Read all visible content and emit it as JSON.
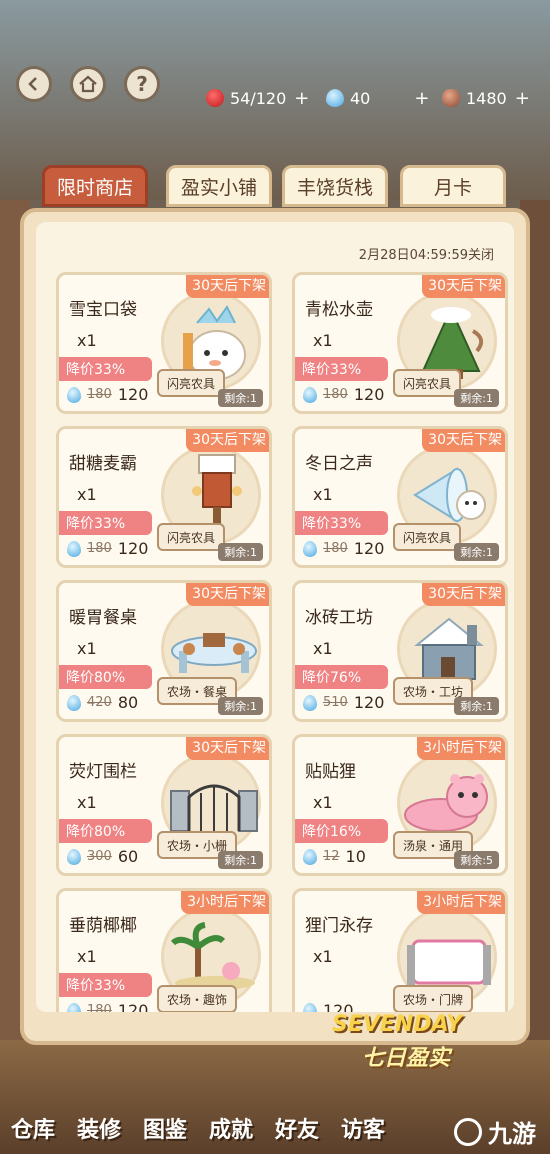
{
  "resources": {
    "apple": {
      "value": "54/120",
      "plus": "+",
      "color": "#d8232a"
    },
    "drop": {
      "value": "40",
      "plus": "+",
      "color": "#4aa8e0"
    },
    "seed": {
      "value": "1480",
      "plus": "+",
      "color": "#8a4a33"
    }
  },
  "header_buttons": {
    "help": "?"
  },
  "tabs": [
    {
      "label": "限时商店",
      "active": true
    },
    {
      "label": "盈实小铺",
      "active": false
    },
    {
      "label": "丰饶货栈",
      "active": false
    },
    {
      "label": "月卡",
      "active": false
    }
  ],
  "closing_time": "2月28日04:59:59关闭",
  "items": [
    {
      "name": "雪宝口袋",
      "qty": "x1",
      "ribbon": "30天后下架",
      "discount": "降价33%",
      "old_price": "180",
      "price": "120",
      "tag": "闪亮农具",
      "remain": "剩余:1"
    },
    {
      "name": "青松水壶",
      "qty": "x1",
      "ribbon": "30天后下架",
      "discount": "降价33%",
      "old_price": "180",
      "price": "120",
      "tag": "闪亮农具",
      "remain": "剩余:1"
    },
    {
      "name": "甜糖麦霸",
      "qty": "x1",
      "ribbon": "30天后下架",
      "discount": "降价33%",
      "old_price": "180",
      "price": "120",
      "tag": "闪亮农具",
      "remain": "剩余:1"
    },
    {
      "name": "冬日之声",
      "qty": "x1",
      "ribbon": "30天后下架",
      "discount": "降价33%",
      "old_price": "180",
      "price": "120",
      "tag": "闪亮农具",
      "remain": "剩余:1"
    },
    {
      "name": "暖胃餐桌",
      "qty": "x1",
      "ribbon": "30天后下架",
      "discount": "降价80%",
      "old_price": "420",
      "price": "80",
      "tag": "农场・餐桌",
      "remain": "剩余:1"
    },
    {
      "name": "冰砖工坊",
      "qty": "x1",
      "ribbon": "30天后下架",
      "discount": "降价76%",
      "old_price": "510",
      "price": "120",
      "tag": "农场・工坊",
      "remain": "剩余:1"
    },
    {
      "name": "荧灯围栏",
      "qty": "x1",
      "ribbon": "30天后下架",
      "discount": "降价80%",
      "old_price": "300",
      "price": "60",
      "tag": "农场・小栅",
      "remain": "剩余:1"
    },
    {
      "name": "贴贴狸",
      "qty": "x1",
      "ribbon": "3小时后下架",
      "discount": "降价16%",
      "old_price": "12",
      "price": "10",
      "tag": "汤泉・通用",
      "remain": "剩余:5"
    },
    {
      "name": "垂荫椰椰",
      "qty": "x1",
      "ribbon": "3小时后下架",
      "discount": "降价33%",
      "old_price": "180",
      "price": "120",
      "tag": "农场・趣饰",
      "remain": ""
    },
    {
      "name": "狸门永存",
      "qty": "x1",
      "ribbon": "3小时后下架",
      "discount": "",
      "old_price": "",
      "price": "120",
      "tag": "农场・门牌",
      "remain": ""
    }
  ],
  "banner": {
    "en": "SEVENDAY",
    "cn": "七日盈实"
  },
  "bottom_nav": [
    "仓库",
    "装修",
    "图鉴",
    "成就",
    "好友",
    "访客"
  ],
  "watermark": "九游",
  "colors": {
    "tab_active": "#c75d3d",
    "ribbon": "#f28b61",
    "discount": "#ef8283",
    "panel": "#f2e1c2"
  }
}
